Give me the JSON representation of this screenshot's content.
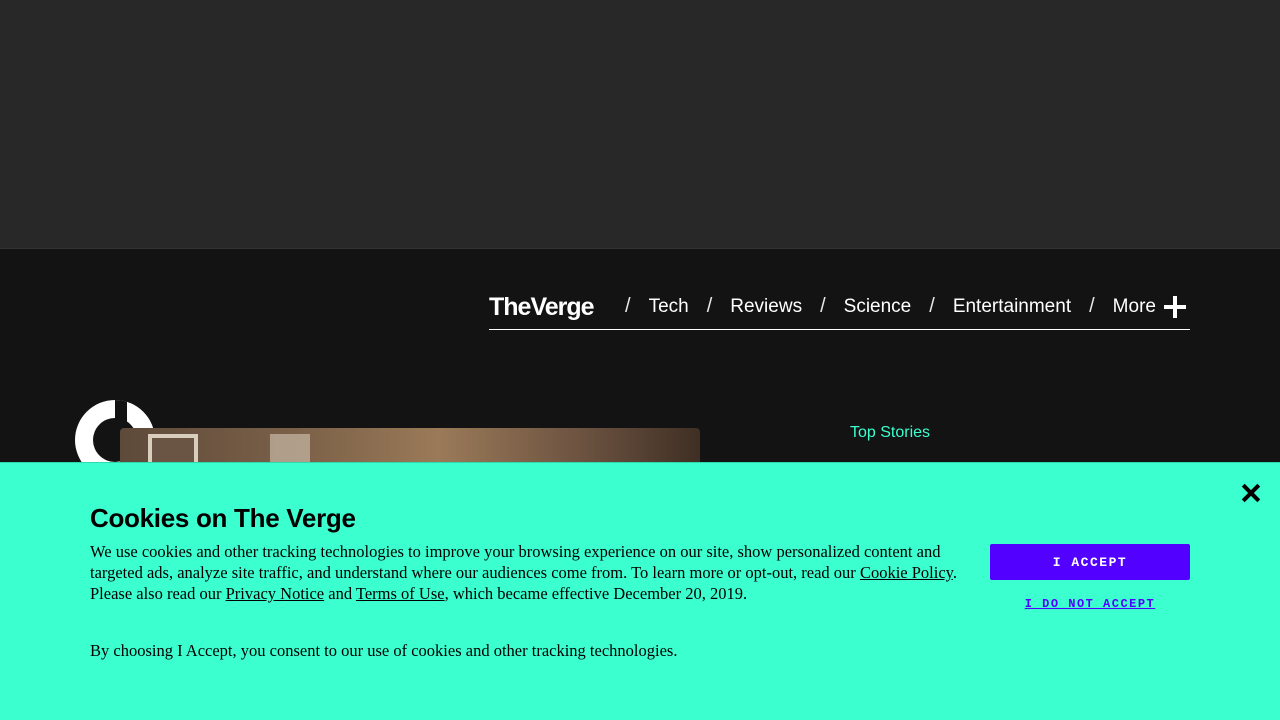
{
  "nav": {
    "logo_text": "TheVerge",
    "items": [
      {
        "label": "Tech"
      },
      {
        "label": "Reviews"
      },
      {
        "label": "Science"
      },
      {
        "label": "Entertainment"
      },
      {
        "label": "More"
      }
    ],
    "separator": "/"
  },
  "sidebar": {
    "heading": "Top Stories"
  },
  "cookie_banner": {
    "title": "Cookies on The Verge",
    "body_part1": "We use cookies and other tracking technologies to improve your browsing experience on our site, show personalized content and targeted ads, analyze site traffic, and understand where our audiences come from. To learn more or opt-out, read our ",
    "cookie_policy_link": "Cookie Policy",
    "body_part2": ". Please also read our ",
    "privacy_notice_link": "Privacy Notice",
    "body_part3": " and ",
    "terms_link": "Terms of Use",
    "body_part4": ", which became effective December 20, 2019.",
    "consent_text": "By choosing I Accept, you consent to our use of cookies and other tracking technologies.",
    "accept_label": "I ACCEPT",
    "decline_label": "I DO NOT ACCEPT"
  },
  "colors": {
    "accent": "#3cffd0",
    "button": "#5200ff",
    "header_bg": "#131313",
    "ad_bg": "#282828"
  }
}
